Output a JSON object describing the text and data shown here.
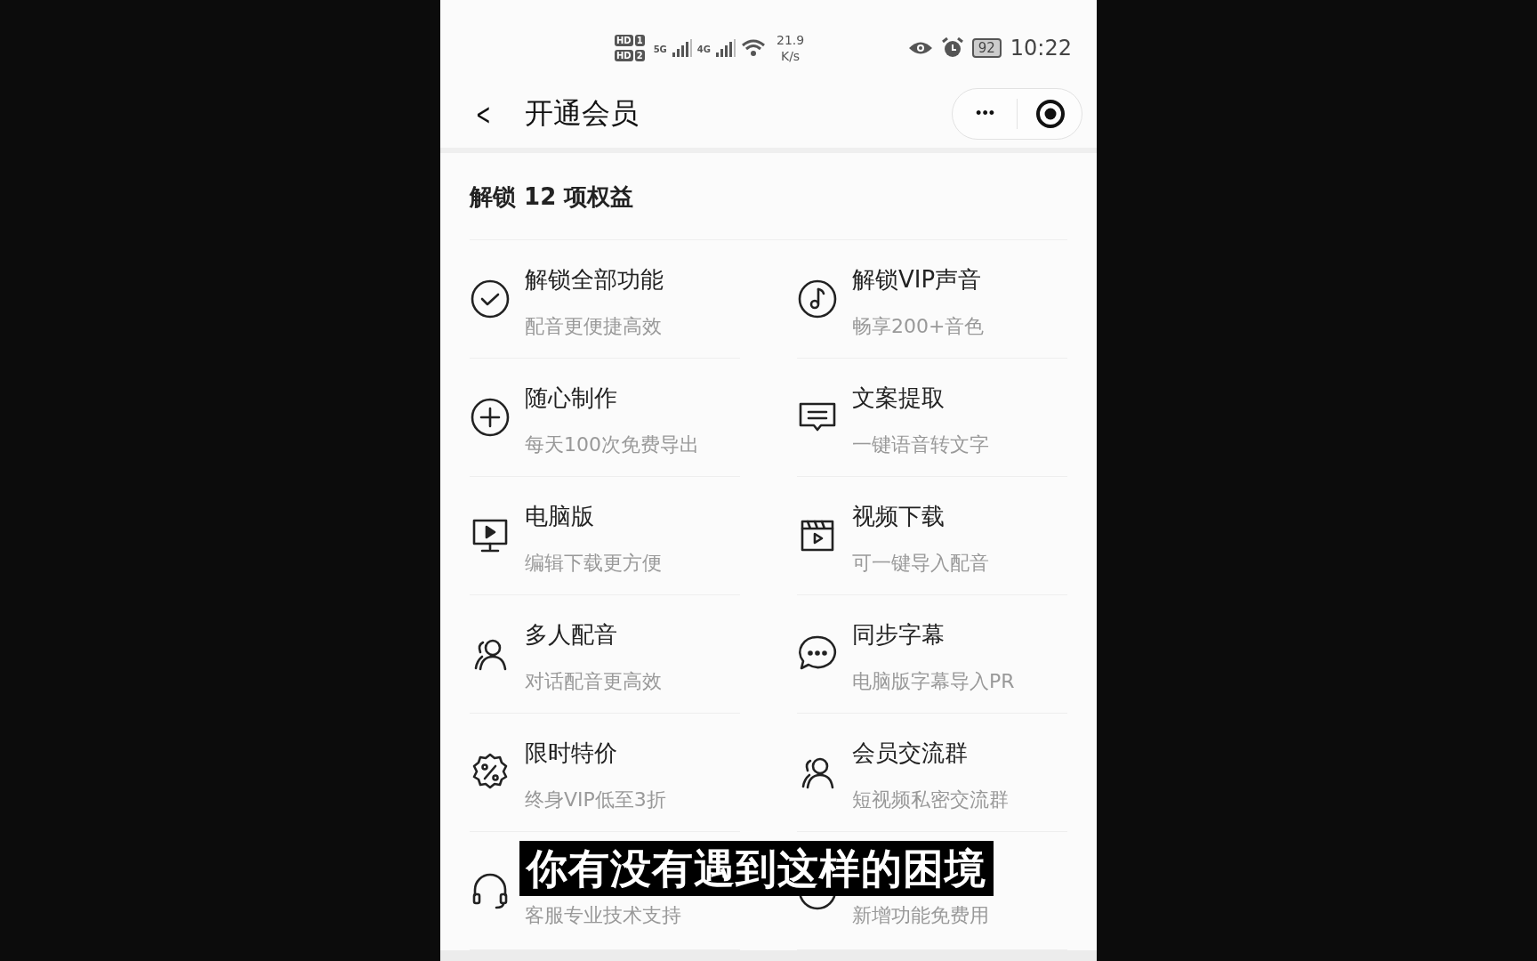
{
  "status_bar": {
    "sims": [
      {
        "badge": "HD",
        "slot": "1"
      },
      {
        "badge": "HD",
        "slot": "2"
      }
    ],
    "networks": [
      "5G",
      "4G"
    ],
    "speed": "21.9",
    "speed_unit": "K/s",
    "battery": "92",
    "time": "10:22"
  },
  "nav": {
    "back": "<",
    "title": "开通会员",
    "more": "•••"
  },
  "section": {
    "heading": "解锁 12 项权益"
  },
  "benefits": [
    {
      "title": "解锁全部功能",
      "desc": "配音更便捷高效"
    },
    {
      "title": "解锁VIP声音",
      "desc": "畅享200+音色"
    },
    {
      "title": "随心制作",
      "desc": "每天100次免费导出"
    },
    {
      "title": "文案提取",
      "desc": "一键语音转文字"
    },
    {
      "title": "电脑版",
      "desc": "编辑下载更方便"
    },
    {
      "title": "视频下载",
      "desc": "可一键导入配音"
    },
    {
      "title": "多人配音",
      "desc": "对话配音更高效"
    },
    {
      "title": "同步字幕",
      "desc": "电脑版字幕导入PR"
    },
    {
      "title": "限时特价",
      "desc": "终身VIP低至3折"
    },
    {
      "title": "会员交流群",
      "desc": "短视频私密交流群"
    },
    {
      "desc": "客服专业技术支持"
    },
    {
      "desc": "新增功能免费用"
    }
  ],
  "subtitle": "你有没有遇到这样的困境"
}
